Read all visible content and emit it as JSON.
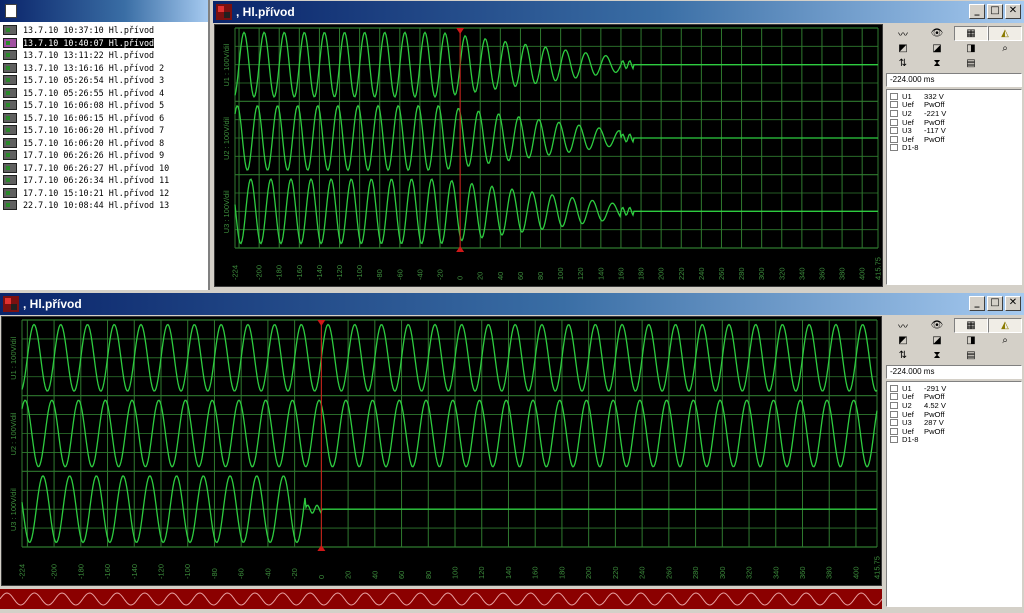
{
  "files": [
    {
      "text": "13.7.10 10:37:10 Hl.přívod",
      "selected": false
    },
    {
      "text": "13.7.10 10:40:07 Hl.přívod",
      "selected": true
    },
    {
      "text": "13.7.10 13:11:22 Hl.přívod",
      "selected": false
    },
    {
      "text": "13.7.10 13:16:16 Hl.přívod 2",
      "selected": false
    },
    {
      "text": "15.7.10 05:26:54 Hl.přívod 3",
      "selected": false
    },
    {
      "text": "15.7.10 05:26:55 Hl.přívod 4",
      "selected": false
    },
    {
      "text": "15.7.10 16:06:08 Hl.přívod 5",
      "selected": false
    },
    {
      "text": "15.7.10 16:06:15 Hl.přívod 6",
      "selected": false
    },
    {
      "text": "15.7.10 16:06:20 Hl.přívod 7",
      "selected": false
    },
    {
      "text": "15.7.10 16:06:20 Hl.přívod 8",
      "selected": false
    },
    {
      "text": "17.7.10 06:26:26 Hl.přívod 9",
      "selected": false
    },
    {
      "text": "17.7.10 06:26:27 Hl.přívod 10",
      "selected": false
    },
    {
      "text": "17.7.10 06:26:34 Hl.přívod 11",
      "selected": false
    },
    {
      "text": "17.7.10 15:10:21 Hl.přívod 12",
      "selected": false
    },
    {
      "text": "22.7.10 10:08:44 Hl.přívod 13",
      "selected": false
    }
  ],
  "windows": [
    {
      "title": ", Hl.přívod",
      "time_readout": "-224.000 ms",
      "channels": [
        {
          "name": "U1",
          "value": "332 V"
        },
        {
          "name": "Uef",
          "value": "PwOff"
        },
        {
          "name": "U2",
          "value": "-221 V"
        },
        {
          "name": "Uef",
          "value": "PwOff"
        },
        {
          "name": "U3",
          "value": "-117 V"
        },
        {
          "name": "Uef",
          "value": "PwOff"
        },
        {
          "name": "D1-8",
          "value": ""
        }
      ],
      "ylabels": [
        "U1 : 100V/dil",
        "U2 : 100V/dil",
        "U3 : 100V/dil"
      ],
      "x_ticks": [
        "-224",
        "-200",
        "-180",
        "-160",
        "-140",
        "-120",
        "-100",
        "-80",
        "-60",
        "-40",
        "-20",
        "0",
        "20",
        "40",
        "60",
        "80",
        "100",
        "120",
        "140",
        "160",
        "180",
        "200",
        "220",
        "240",
        "260",
        "280",
        "300",
        "320",
        "340",
        "360",
        "380",
        "400",
        "415.75"
      ],
      "cursor_ms": 0,
      "collapse_ms": [
        160,
        160,
        160
      ]
    },
    {
      "title": ", Hl.přívod",
      "time_readout": "-224.000 ms",
      "channels": [
        {
          "name": "U1",
          "value": "-291 V"
        },
        {
          "name": "Uef",
          "value": "PwOff"
        },
        {
          "name": "U2",
          "value": "4.52 V"
        },
        {
          "name": "Uef",
          "value": "PwOff"
        },
        {
          "name": "U3",
          "value": "287 V"
        },
        {
          "name": "Uef",
          "value": "PwOff"
        },
        {
          "name": "D1-8",
          "value": ""
        }
      ],
      "ylabels": [
        "U1 : 100V/dil",
        "U2 : 100V/dil",
        "U3 : 100V/dil"
      ],
      "x_ticks": [
        "-224",
        "-200",
        "-180",
        "-160",
        "-140",
        "-120",
        "-100",
        "-80",
        "-60",
        "-40",
        "-20",
        "0",
        "20",
        "40",
        "60",
        "80",
        "100",
        "120",
        "140",
        "160",
        "180",
        "200",
        "220",
        "240",
        "260",
        "280",
        "300",
        "320",
        "340",
        "360",
        "380",
        "400",
        "415.75"
      ],
      "cursor_ms": 0,
      "collapse_ms": [
        null,
        null,
        -12
      ]
    }
  ],
  "colors": {
    "trace": "#2ecc40",
    "grid": "#2f7a2f",
    "cursor": "#d01818",
    "background": "#000000"
  }
}
